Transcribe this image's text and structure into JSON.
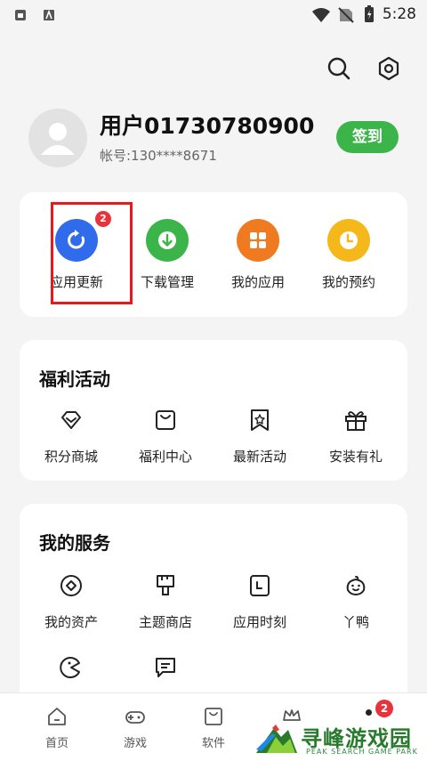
{
  "status_bar": {
    "time": "5:28"
  },
  "profile": {
    "username": "用户01730780900",
    "account": "帐号:130****8671",
    "signin_label": "签到"
  },
  "quick_actions": [
    {
      "label": "应用更新",
      "icon": "refresh-icon",
      "color": "#2f6bea",
      "badge": "2"
    },
    {
      "label": "下载管理",
      "icon": "download-icon",
      "color": "#3bb54a"
    },
    {
      "label": "我的应用",
      "icon": "apps-grid-icon",
      "color": "#f07a20"
    },
    {
      "label": "我的预约",
      "icon": "clock-icon",
      "color": "#f5b81a"
    }
  ],
  "benefits": {
    "title": "福利活动",
    "items": [
      {
        "label": "积分商城",
        "icon": "diamond-icon"
      },
      {
        "label": "福利中心",
        "icon": "bag-icon"
      },
      {
        "label": "最新活动",
        "icon": "star-bookmark-icon"
      },
      {
        "label": "安装有礼",
        "icon": "gift-icon"
      }
    ]
  },
  "services": {
    "title": "我的服务",
    "items": [
      {
        "label": "我的资产",
        "icon": "asset-icon"
      },
      {
        "label": "主题商店",
        "icon": "brush-icon"
      },
      {
        "label": "应用时刻",
        "icon": "calendar-icon"
      },
      {
        "label": "丫鸭",
        "icon": "duck-icon"
      },
      {
        "label": "",
        "icon": "pacman-icon"
      },
      {
        "label": "",
        "icon": "chat-icon"
      }
    ]
  },
  "bottom_nav": [
    {
      "label": "首页",
      "icon": "home-icon"
    },
    {
      "label": "游戏",
      "icon": "gamepad-icon"
    },
    {
      "label": "软件",
      "icon": "shopping-bag-icon"
    },
    {
      "label": "",
      "icon": "crown-icon"
    }
  ],
  "nav_badge": "2",
  "watermark": {
    "title": "寻峰游戏园",
    "subtitle": "PEAK SEARCH GAME PARK"
  }
}
